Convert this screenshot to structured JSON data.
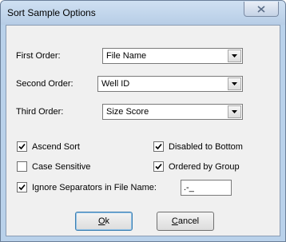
{
  "window": {
    "title": "Sort Sample Options"
  },
  "fields": {
    "first_order": {
      "label": "First Order:",
      "value": "File Name"
    },
    "second_order": {
      "label": "Second Order:",
      "value": "Well ID"
    },
    "third_order": {
      "label": "Third Order:",
      "value": "Size Score"
    }
  },
  "checkboxes": {
    "ascend_sort": {
      "label": "Ascend Sort",
      "checked": true
    },
    "disabled_to_bottom": {
      "label": "Disabled to Bottom",
      "checked": true
    },
    "case_sensitive": {
      "label": "Case Sensitive",
      "checked": false
    },
    "ordered_by_group": {
      "label": "Ordered by Group",
      "checked": true
    },
    "ignore_separators": {
      "label": "Ignore Separators in File Name:",
      "checked": true
    }
  },
  "separators": {
    "value": ".-_"
  },
  "buttons": {
    "ok": {
      "mnemonic": "O",
      "rest": "k"
    },
    "cancel": {
      "mnemonic": "C",
      "rest": "ancel"
    }
  }
}
